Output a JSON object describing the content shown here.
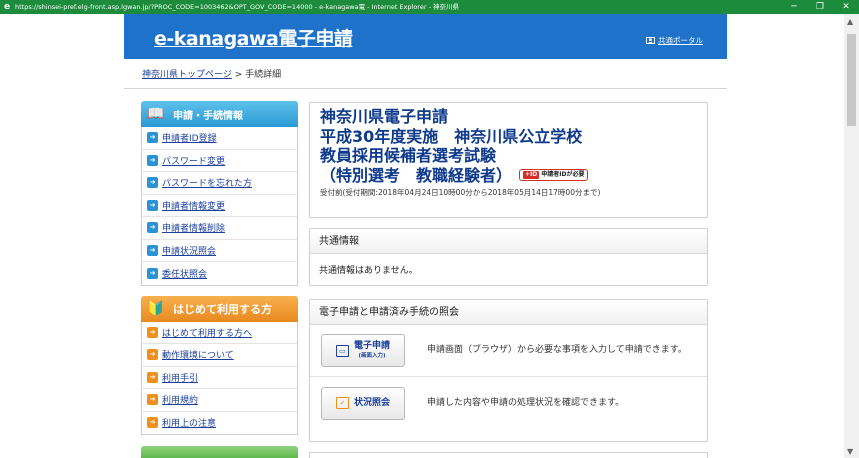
{
  "window": {
    "title": "https://shinsei-pref.elg-front.asp.lgwan.jp/?PROC_CODE=1003462&OPT_GOV_CODE=14000 - e-kanagawa電 - Internet Explorer - 神奈川県",
    "minimize": "─",
    "restore": "❐",
    "close": "✕"
  },
  "header": {
    "logo": "e-kanagawa電子申請",
    "portal_link": "共通ポータル"
  },
  "breadcrumb": {
    "home": "神奈川県トップページ",
    "separator": ">",
    "current": "手続詳細"
  },
  "sidebar": {
    "section1": {
      "title": "申請・手続情報",
      "items": [
        "申請者ID登録",
        "パスワード変更",
        "パスワードを忘れた方",
        "申請者情報変更",
        "申請者情報削除",
        "申請状況照会",
        "委任状照会"
      ]
    },
    "section2": {
      "title": "はじめて利用する方",
      "items": [
        "はじめて利用する方へ",
        "動作環境について",
        "利用手引",
        "利用規約",
        "利用上の注意"
      ]
    }
  },
  "procedure": {
    "title_line1": "神奈川県電子申請",
    "title_line2": "平成30年度実施　神奈川県公立学校",
    "title_line3": "教員採用候補者選考試験",
    "title_line4": "（特別選考　教職経験者）",
    "id_badge_icon": "+ID",
    "id_badge": "申請者IDが必要",
    "period": "受付前(受付期間:2018年04月24日10時00分から2018年05月14日17時00分まで)"
  },
  "common_info": {
    "heading": "共通情報",
    "body": "共通情報はありません。"
  },
  "apply": {
    "heading": "電子申請と申請済み手続の照会",
    "apply_button": "電子申請",
    "apply_button_sub": "(画面入力)",
    "apply_desc": "申請画面（ブラウザ）から必要な事項を入力して申請できます。",
    "status_button": "状況照会",
    "status_desc": "申請した内容や申請の処理状況を確認できます。"
  },
  "icons": {
    "browser": "ie-icon",
    "section1": "book-icon",
    "section2": "beginner-mark-icon",
    "arrow": "arrow-right-icon"
  }
}
